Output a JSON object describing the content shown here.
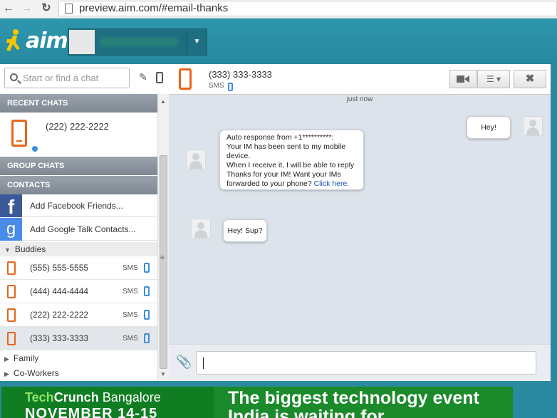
{
  "browser": {
    "back_icon": "back-arrow-icon",
    "forward_icon": "forward-arrow-icon",
    "reload_icon": "reload-icon",
    "url": "preview.aim.com/#email-thanks"
  },
  "aim": {
    "logo_text": "aim",
    "colors": {
      "brand": "#2b8aa0",
      "phone_accent": "#e8651b",
      "sms_accent": "#3c8fd9"
    }
  },
  "sidebar": {
    "search_placeholder": "Start or find a chat",
    "recent_header": "RECENT CHATS",
    "recent_item": "(222) 222-2222",
    "group_header": "GROUP CHATS",
    "contacts_header": "CONTACTS",
    "add_facebook": "Add Facebook Friends...",
    "add_google": "Add Google Talk Contacts...",
    "buddies_group": "Buddies",
    "buddies": [
      {
        "number": "(555) 555-5555",
        "tag": "SMS"
      },
      {
        "number": "(444) 444-4444",
        "tag": "SMS"
      },
      {
        "number": "(222) 222-2222",
        "tag": "SMS"
      },
      {
        "number": "(333) 333-3333",
        "tag": "SMS"
      }
    ],
    "family_group": "Family",
    "coworkers_group": "Co-Workers"
  },
  "chat": {
    "contact_number": "(333) 333-3333",
    "contact_tag": "SMS",
    "timestamp": "just now",
    "messages": {
      "out1": "Hey!",
      "auto_lines": [
        "Auto response from +1**********:",
        "Your IM has been sent to my mobile",
        "device.",
        "When I receive it, I will be able to reply",
        "Thanks for your IM! Want your IMs",
        " forwarded to your phone?"
      ],
      "auto_link": "Click here.",
      "in2": "Hey! Sup?"
    }
  },
  "ad": {
    "brand_tech": "Tech",
    "brand_crunch": "Crunch",
    "brand_city": " Bangalore",
    "dates": "NOVEMBER 14-15",
    "headline1": "The biggest technology event",
    "headline2": "India is waiting for"
  }
}
